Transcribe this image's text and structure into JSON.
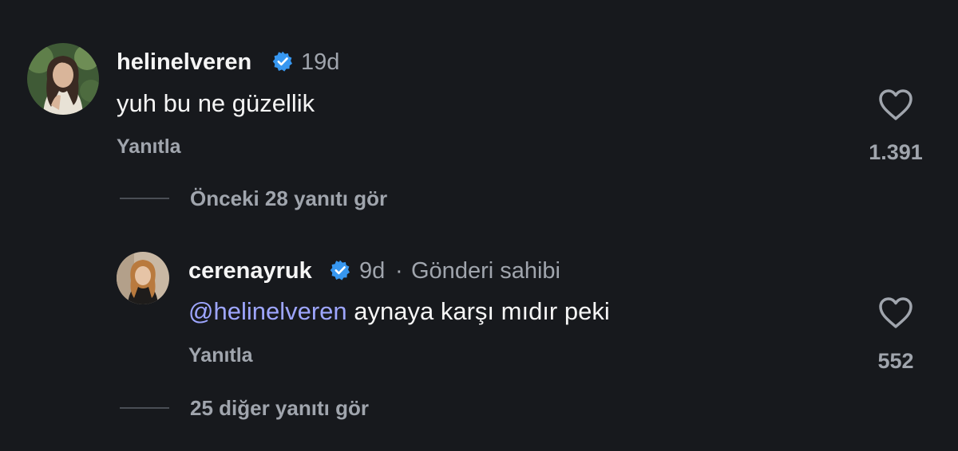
{
  "comments": [
    {
      "username": "helinelveren",
      "verified": true,
      "time": "19d",
      "text": "yuh bu ne güzellik",
      "reply_label": "Yanıtla",
      "likes": "1.391",
      "view_replies": "Önceki 28 yanıtı gör"
    },
    {
      "username": "cerenayruk",
      "verified": true,
      "time": "9d",
      "author_separator": "·",
      "author_label": "Gönderi sahibi",
      "mention": "@helinelveren",
      "text": "aynaya karşı mıdır peki",
      "reply_label": "Yanıtla",
      "likes": "552",
      "view_replies": "25 diğer yanıtı gör"
    }
  ],
  "colors": {
    "background": "#17191d",
    "verified": "#3797f0",
    "mention": "#9ea6ff",
    "muted": "#a0a5ad"
  }
}
